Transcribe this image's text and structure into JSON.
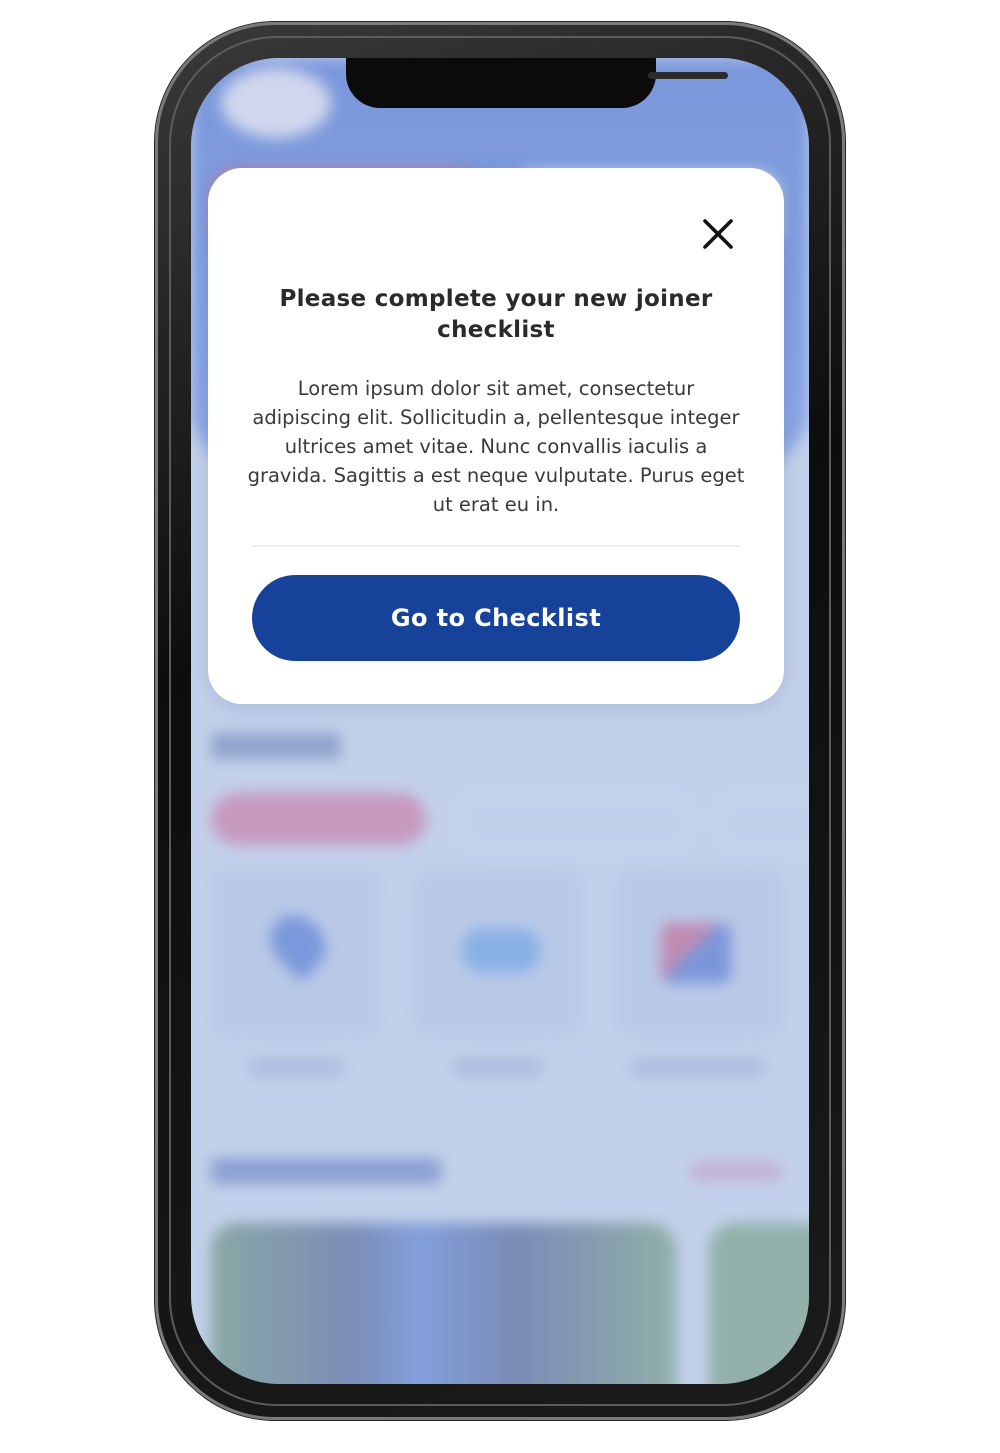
{
  "modal": {
    "title": "Please complete your new joiner checklist",
    "body": "Lorem ipsum dolor sit amet, consectetur adipiscing elit. Sollicitudin a, pellentesque integer ultrices amet vitae. Nunc convallis iaculis a gravida. Sagittis a est neque vulputate. Purus eget ut erat eu in.",
    "primary_button_label": "Go to Checklist",
    "close_icon": "close-icon"
  },
  "colors": {
    "primary_button": "#17429a",
    "modal_background": "#ffffff",
    "background_overlay": "#bccde9",
    "header_blue": "#2a55c8",
    "accent_pink": "#b0306a"
  }
}
